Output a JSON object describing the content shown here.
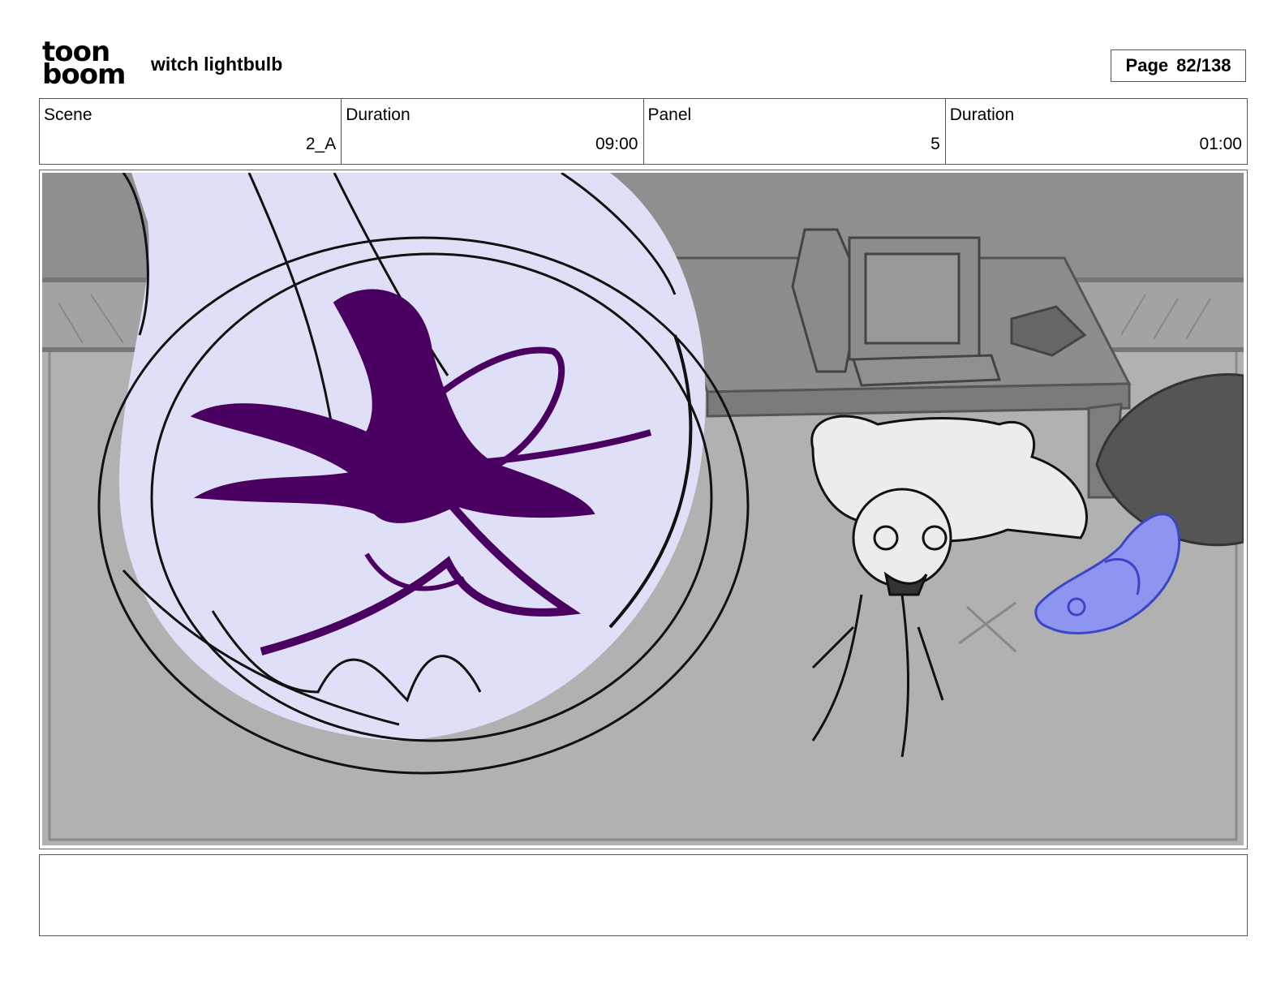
{
  "header": {
    "logo": {
      "line1": "toon",
      "line2": "boom"
    },
    "title": "witch lightbulb",
    "page_label": "Page",
    "page_number": "82/138"
  },
  "info": {
    "scene_label": "Scene",
    "scene_value": "2_A",
    "scene_duration_label": "Duration",
    "scene_duration_value": "09:00",
    "panel_label": "Panel",
    "panel_value": "5",
    "panel_duration_label": "Duration",
    "panel_duration_value": "01:00"
  },
  "notes": {
    "text": ""
  },
  "colors": {
    "background_grey": "#b1b1b1",
    "wall_grey": "#8f8f8f",
    "bulb_fill": "#dfe0f7",
    "filament_purple": "#4a0060",
    "creature_blue": "#8e95f0",
    "line_black": "#111111"
  }
}
